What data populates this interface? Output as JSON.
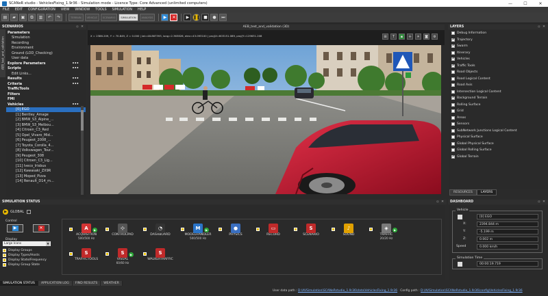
{
  "window": {
    "title": "SCANeR studio - VehiclesFixing_1.9r36 - Simulation mode - Licence Type: Core Advanced (unlimited computers)"
  },
  "menu": [
    "FILE",
    "EDIT",
    "CONFIGURATION",
    "VIEW",
    "WINDOW",
    "TOOLS",
    "SIMULATION",
    "HELP"
  ],
  "toolbar": {
    "text_buttons": [
      "TERRAIN",
      "VEHICLE",
      "SCENARIO",
      "SIMULATION",
      "ANALYSIS"
    ]
  },
  "scenarios": {
    "title": "SCENARIOS",
    "vertical_tab": "AEB_test_and_validation",
    "tree": [
      {
        "label": "Parameters",
        "kind": "h",
        "indent": 0,
        "dots": false
      },
      {
        "label": "Simulation",
        "kind": "c",
        "indent": 1
      },
      {
        "label": "Recording",
        "kind": "c",
        "indent": 1
      },
      {
        "label": "Environment",
        "kind": "c",
        "indent": 1
      },
      {
        "label": "Ground (LOD_Checking)",
        "kind": "c",
        "indent": 1
      },
      {
        "label": "User data",
        "kind": "c",
        "indent": 1
      },
      {
        "label": "Explore Parameters",
        "kind": "h",
        "indent": 0,
        "dots": true
      },
      {
        "label": "Scripts",
        "kind": "h",
        "indent": 0,
        "dots": true
      },
      {
        "label": "Edit Links...",
        "kind": "c",
        "indent": 1
      },
      {
        "label": "Results",
        "kind": "h",
        "indent": 0,
        "dots": true
      },
      {
        "label": "Criteria",
        "kind": "h",
        "indent": 0,
        "dots": true
      },
      {
        "label": "TrafficTools",
        "kind": "h",
        "indent": 0
      },
      {
        "label": "Filters",
        "kind": "h",
        "indent": 0
      },
      {
        "label": "FMI",
        "kind": "h",
        "indent": 0
      },
      {
        "label": "Vehicles",
        "kind": "h",
        "indent": 0,
        "dots": true
      },
      {
        "label": "[0] EGO",
        "kind": "sel",
        "indent": 2
      },
      {
        "label": "[1] Bentley_Amage",
        "kind": "c",
        "indent": 2
      },
      {
        "label": "[2] BMW_S3_Alpine_...",
        "kind": "c",
        "indent": 2
      },
      {
        "label": "[3] BMW_S3_Melbou...",
        "kind": "c",
        "indent": 2
      },
      {
        "label": "[4] Citroen_C3_Red",
        "kind": "c",
        "indent": 2
      },
      {
        "label": "[5] Opel_Vivaro_Mid...",
        "kind": "c",
        "indent": 2
      },
      {
        "label": "[6] Peugeot_2008_...",
        "kind": "c",
        "indent": 2
      },
      {
        "label": "[7] Toyota_Corolla_4...",
        "kind": "c",
        "indent": 2
      },
      {
        "label": "[8] Volkswagen_Tour...",
        "kind": "c",
        "indent": 2
      },
      {
        "label": "[9] Peugeot_308",
        "kind": "c",
        "indent": 2
      },
      {
        "label": "[10] Citroen_C3_Lig...",
        "kind": "c",
        "indent": 2
      },
      {
        "label": "[11] Iveco_Irisbus",
        "kind": "c",
        "indent": 2
      },
      {
        "label": "[12] Kawasaki_ZX9R",
        "kind": "c",
        "indent": 2
      },
      {
        "label": "[13] Moped_Pizza",
        "kind": "c",
        "indent": 2
      },
      {
        "label": "[14] Renault_D14_m...",
        "kind": "c",
        "indent": 2
      }
    ]
  },
  "view3d": {
    "title": "AEB_test_and_validation (3D)",
    "coords": "X = 2386.209, Y = 70.849, Z = 0.000 | lat=48.867393, long=2.363826, elev=43.093100 | proj(X=603151.089, proj(Y=129631.208"
  },
  "layers": {
    "title": "LAYERS",
    "items": [
      {
        "label": "Debug Information",
        "checked": false
      },
      {
        "label": "Trajectory",
        "checked": true
      },
      {
        "label": "Swarm",
        "checked": true
      },
      {
        "label": "Itinerary",
        "checked": false
      },
      {
        "label": "Vehicles",
        "checked": true
      },
      {
        "label": "Traffic Tools",
        "checked": true
      },
      {
        "label": "Road Objects",
        "checked": false
      },
      {
        "label": "Road Logical Content",
        "checked": false
      },
      {
        "label": "Road Axis",
        "checked": false
      },
      {
        "label": "Intersection Logical Content",
        "checked": false
      },
      {
        "label": "Background Terrain",
        "checked": true
      },
      {
        "label": "Rolling Surface",
        "checked": false
      },
      {
        "label": "Grid",
        "checked": false
      },
      {
        "label": "Areas",
        "checked": false
      },
      {
        "label": "Sensors",
        "checked": false
      },
      {
        "label": "SubNetwork Junctions Logical Content",
        "checked": false
      },
      {
        "label": "Physical Surface",
        "checked": false
      },
      {
        "label": "Global Physical Surface",
        "checked": false
      },
      {
        "label": "Global Rolling Surface",
        "checked": false
      },
      {
        "label": "Global Terrain",
        "checked": true
      }
    ],
    "tabs": [
      "RESOURCES",
      "LAYERS"
    ]
  },
  "simstatus": {
    "title": "SIMULATION STATUS",
    "global": "GLOBAL",
    "control_label": "Control",
    "display_label": "Display",
    "display_select": "Large Icons",
    "display_options": [
      "Display Groups",
      "Display Types/Hosts",
      "Display State/Frequency",
      "Display Group State"
    ],
    "modules": [
      {
        "name": "ACQUISITION",
        "sub": "500/500 Hz",
        "color": "#d43434",
        "glyph": "A",
        "status": true
      },
      {
        "name": "CONTROLPAD",
        "sub": "",
        "color": "#555555",
        "glyph": "⊹",
        "status": false
      },
      {
        "name": "DASHBOARD",
        "sub": "",
        "color": "#333333",
        "glyph": "◔",
        "status": false
      },
      {
        "name": "MODELHANDLER",
        "sub": "500/500 Hz",
        "color": "#2a74c8",
        "glyph": "M",
        "status": true
      },
      {
        "name": "PHYSICS",
        "sub": "",
        "color": "#3a6fc0",
        "glyph": "●",
        "status": false
      },
      {
        "name": "RECORD",
        "sub": "",
        "color": "#c02a2a",
        "glyph": "▭",
        "status": false
      },
      {
        "name": "SCENARIO",
        "sub": "",
        "color": "#c02a2a",
        "glyph": "S",
        "status": false
      },
      {
        "name": "SOUND",
        "sub": "",
        "color": "#e0a000",
        "glyph": "♪",
        "status": false
      },
      {
        "name": "TRAFFIC",
        "sub": "20/20 Hz",
        "color": "#7a7a7a",
        "glyph": "◈",
        "status": true
      },
      {
        "name": "TRAFFICTOOLS",
        "sub": "",
        "color": "#c02a2a",
        "glyph": "S",
        "status": false
      },
      {
        "name": "VISUAL",
        "sub": "60/60 Hz",
        "color": "#c02a2a",
        "glyph": "S",
        "status": true
      },
      {
        "name": "WALKERTRAFFIC",
        "sub": "",
        "color": "#c02a2a",
        "glyph": "S",
        "status": false
      }
    ]
  },
  "dashboard": {
    "title": "DASHBOARD",
    "vehicle_group": "Vehicle",
    "vehicle": "[0] EGO",
    "x_label": "X:",
    "x_value": "2394.844 m",
    "y_label": "Y:",
    "y_value": "-5.199 m",
    "z_label": "Z:",
    "z_value": "0.002 m",
    "speed_label": "Speed",
    "speed_value": "0.000 km/h",
    "time_group": "Simulation Time",
    "time_value": "00:00:19.719",
    "tabs": [
      "DASHBOARD",
      "VIDEORECORD"
    ]
  },
  "statusbar": {
    "tabs": [
      "SIMULATION STATUS",
      "APPLICATION LOG",
      "FIND RESULTS",
      "WEATHER"
    ],
    "user_data_label": "User data path :",
    "user_data_path": "D:\\AVSimulation\\SCANeRstudio_1.9r36\\data\\VehiclesFixing_1.9r36",
    "config_label": "Config path :",
    "config_path": "D:\\AVSimulation\\SCANeRstudio_1.9r36\\config\\VehiclesFixing_1.9r36"
  }
}
